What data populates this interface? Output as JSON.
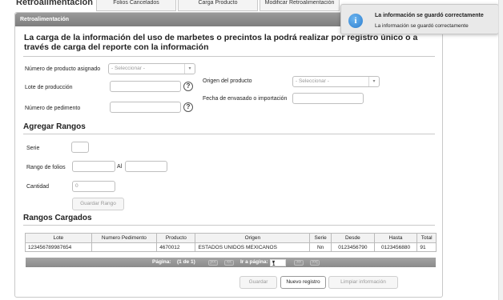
{
  "tabs": [
    {
      "label": "Retroalimentación",
      "active": true
    },
    {
      "label": "Folios Cancelados",
      "active": false
    },
    {
      "label": "Carga Producto",
      "active": false
    },
    {
      "label": "Modificar Retroalimentación",
      "active": false
    }
  ],
  "panel": {
    "header": "Retroalimentación",
    "intro": "La carga de la información del uso de marbetes o precintos la podrá realizar por registro único o a través de carga del reporte con la información"
  },
  "form": {
    "product_number_label": "Número de producto asignado",
    "product_number_placeholder": "- Seleccionar -",
    "lot_label": "Lote de producción",
    "lot_value": "",
    "origin_label": "Origen del producto",
    "origin_placeholder": "- Seleccionar -",
    "bottling_date_label": "Fecha de envasado o importación",
    "bottling_date_value": "",
    "pedimento_label": "Número de pedimento",
    "pedimento_value": "",
    "help_glyph": "?"
  },
  "ranges": {
    "title": "Agregar Rangos",
    "serie_label": "Serie",
    "serie_value": "",
    "folio_range_label": "Rango de folios",
    "folio_from_value": "",
    "to_label": "Al",
    "folio_to_value": "",
    "quantity_label": "Cantidad",
    "quantity_value": "0",
    "save_range_button": "Guardar Rango"
  },
  "loaded": {
    "title": "Rangos Cargados",
    "columns": [
      "Lote",
      "Numero Pedimento",
      "Producto",
      "Origen",
      "Serie",
      "Desde",
      "Hasta",
      "Total"
    ],
    "rows": [
      [
        "123456789987654",
        "",
        "4670012",
        "ESTADOS UNIDOS MEXICANOS",
        "Nn",
        "0123456790",
        "0123456880",
        "91"
      ]
    ],
    "pager": {
      "page_label": "Página:",
      "page_of": "(1 de 1)",
      "first": "|<<",
      "prev": "<<",
      "goto_label": "Ir a página:",
      "goto_value": "1",
      "next": ">>",
      "last": ">>|"
    }
  },
  "actions": {
    "save": "Guardar",
    "new_record": "Nuevo registro",
    "clear": "Limpiar información"
  },
  "toast": {
    "icon": "info-icon",
    "icon_glyph": "i",
    "title": "La información se guardó correctamente",
    "message": "La información se guardó correctamente"
  },
  "colors": {
    "header_gray": "#8a8a8a",
    "info_blue": "#2f7fcf"
  }
}
